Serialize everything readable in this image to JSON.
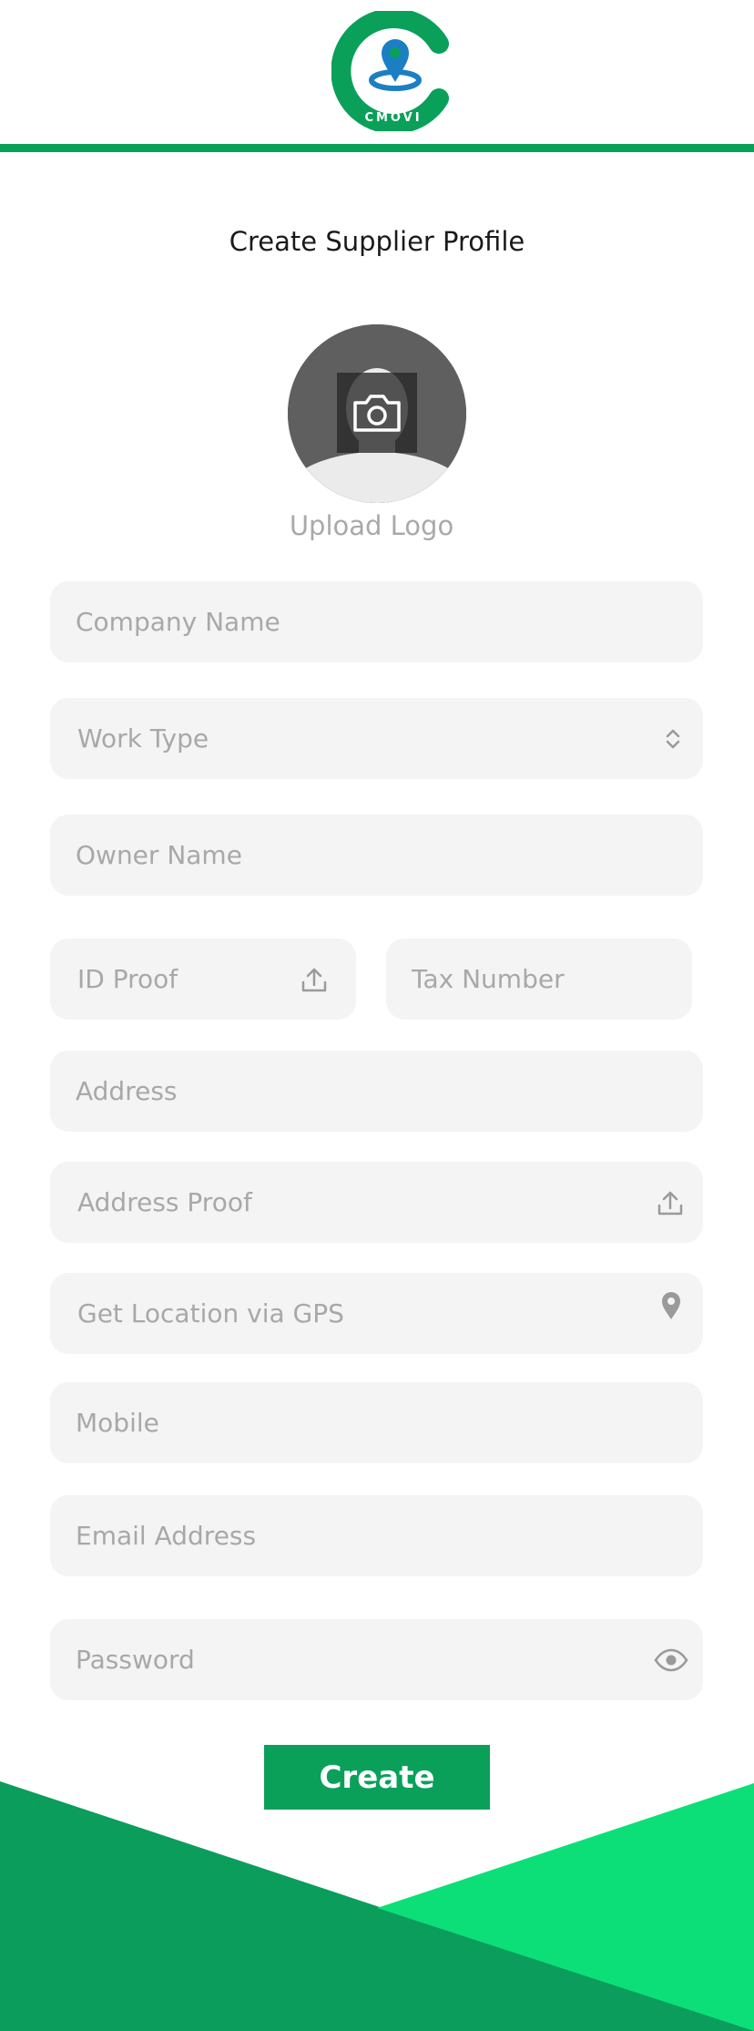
{
  "brand": {
    "logo_text": "CMOVI",
    "primary_color": "#0aa05a",
    "accent_color": "#0ddf78",
    "pin_color": "#1c7fc4"
  },
  "page": {
    "title": "Create Supplier Profile"
  },
  "logo_upload": {
    "label": "Upload Logo",
    "icon": "camera-icon"
  },
  "form": {
    "company_name": {
      "placeholder": "Company Name"
    },
    "work_type": {
      "placeholder": "Work Type",
      "icon": "chevron-up-down-icon"
    },
    "owner_name": {
      "placeholder": "Owner Name"
    },
    "id_proof": {
      "placeholder": "ID Proof",
      "icon": "upload-icon"
    },
    "tax_number": {
      "placeholder": "Tax Number"
    },
    "address": {
      "placeholder": "Address"
    },
    "address_proof": {
      "placeholder": "Address Proof",
      "icon": "upload-icon"
    },
    "gps_location": {
      "placeholder": "Get Location via GPS",
      "icon": "location-pin-icon"
    },
    "mobile": {
      "placeholder": "Mobile"
    },
    "email": {
      "placeholder": "Email Address"
    },
    "password": {
      "placeholder": "Password",
      "icon": "eye-icon"
    }
  },
  "actions": {
    "create_label": "Create"
  }
}
